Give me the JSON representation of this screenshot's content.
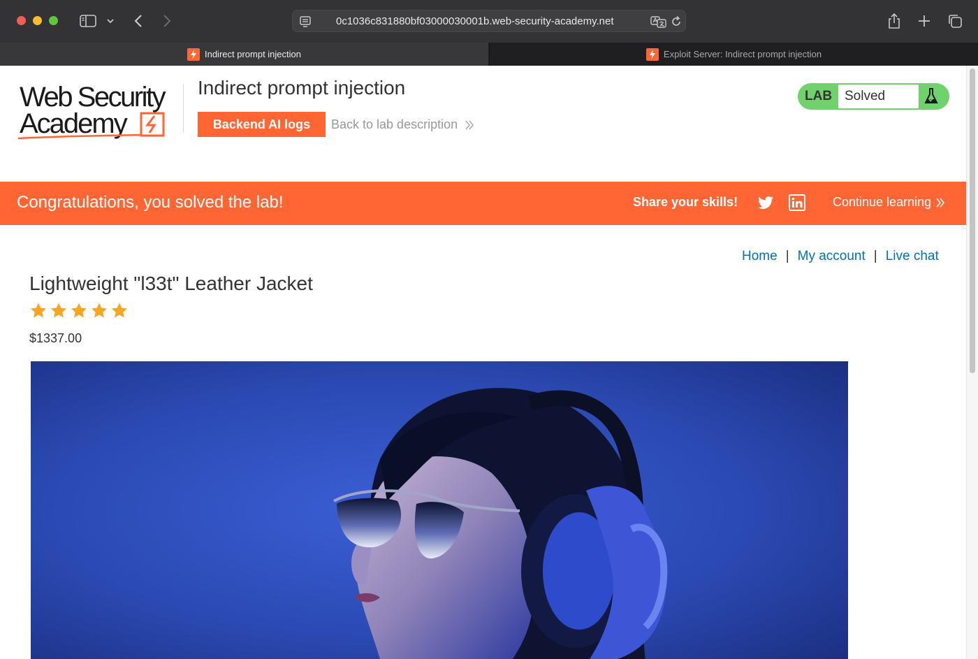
{
  "browser": {
    "url": "0c1036c831880bf03000030001b.web-security-academy.net",
    "tabs": [
      {
        "label": "Indirect prompt injection",
        "active": true
      },
      {
        "label": "Exploit Server: Indirect prompt injection",
        "active": false
      }
    ]
  },
  "header": {
    "logo_line1": "Web Security",
    "logo_line2": "Academy",
    "lab_title": "Indirect prompt injection",
    "backend_button": "Backend AI logs",
    "back_link": "Back to lab description",
    "lab_label": "LAB",
    "lab_status": "Solved"
  },
  "banner": {
    "message": "Congratulations, you solved the lab!",
    "share": "Share your skills!",
    "continue": "Continue learning"
  },
  "nav": {
    "home": "Home",
    "separator": "|",
    "my_account": "My account",
    "live_chat": "Live chat"
  },
  "product": {
    "title": "Lightweight \"l33t\" Leather Jacket",
    "rating": 5,
    "rating_max": 5,
    "price": "$1337.00"
  },
  "colors": {
    "accent": "#ff6633",
    "link": "#0071bc",
    "lab_green": "#70d16d",
    "star": "#f5a623"
  }
}
